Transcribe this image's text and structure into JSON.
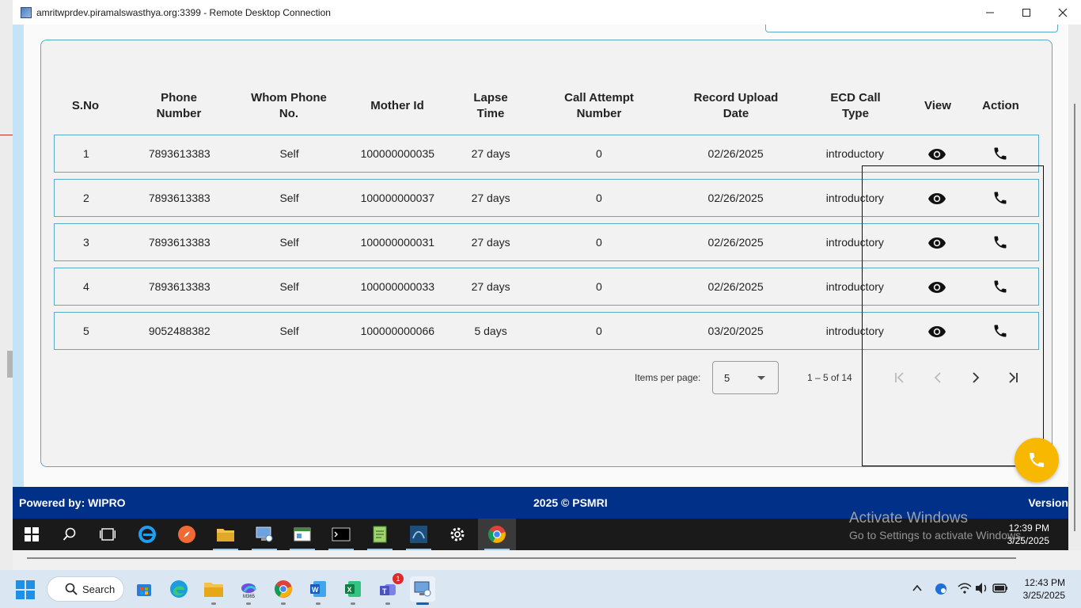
{
  "rdp": {
    "title": "amritwprdev.piramalswasthya.org:3399 - Remote Desktop Connection",
    "controls": {
      "minimize": "—",
      "maximize": "☐",
      "close": "✕"
    }
  },
  "table": {
    "headers": {
      "sno": "S.No",
      "phone_l1": "Phone",
      "phone_l2": "Number",
      "whom_l1": "Whom Phone",
      "whom_l2": "No.",
      "mother": "Mother Id",
      "lapse_l1": "Lapse",
      "lapse_l2": "Time",
      "attempt_l1": "Call Attempt",
      "attempt_l2": "Number",
      "upload_l1": "Record Upload",
      "upload_l2": "Date",
      "ecd_l1": "ECD Call",
      "ecd_l2": "Type",
      "view": "View",
      "action": "Action"
    },
    "rows": [
      {
        "sno": "1",
        "phone": "7893613383",
        "whom": "Self",
        "mother": "100000000035",
        "lapse": "27 days",
        "attempt": "0",
        "upload": "02/26/2025",
        "type": "introductory"
      },
      {
        "sno": "2",
        "phone": "7893613383",
        "whom": "Self",
        "mother": "100000000037",
        "lapse": "27 days",
        "attempt": "0",
        "upload": "02/26/2025",
        "type": "introductory"
      },
      {
        "sno": "3",
        "phone": "7893613383",
        "whom": "Self",
        "mother": "100000000031",
        "lapse": "27 days",
        "attempt": "0",
        "upload": "02/26/2025",
        "type": "introductory"
      },
      {
        "sno": "4",
        "phone": "7893613383",
        "whom": "Self",
        "mother": "100000000033",
        "lapse": "27 days",
        "attempt": "0",
        "upload": "02/26/2025",
        "type": "introductory"
      },
      {
        "sno": "5",
        "phone": "9052488382",
        "whom": "Self",
        "mother": "100000000066",
        "lapse": "5 days",
        "attempt": "0",
        "upload": "03/20/2025",
        "type": "introductory"
      }
    ]
  },
  "paginator": {
    "items_per_page_label": "Items per page:",
    "items_per_page_value": "5",
    "range_label": "1 – 5 of 14"
  },
  "footer": {
    "powered_by": "Powered by: WIPRO",
    "copyright": "2025 © PSMRI",
    "version": "Version"
  },
  "remote_desktop": {
    "activate_title": "Activate Windows",
    "activate_sub": "Go to Settings to activate Windows.",
    "time": "12:39 PM",
    "date": "3/25/2025"
  },
  "taskbar": {
    "search_label": "Search",
    "teams_badge": "1",
    "time": "12:43 PM",
    "date": "3/25/2025"
  },
  "colors": {
    "accent_border": "#5aa9c9",
    "footer_bg": "#003087",
    "fab": "#f9b800"
  }
}
